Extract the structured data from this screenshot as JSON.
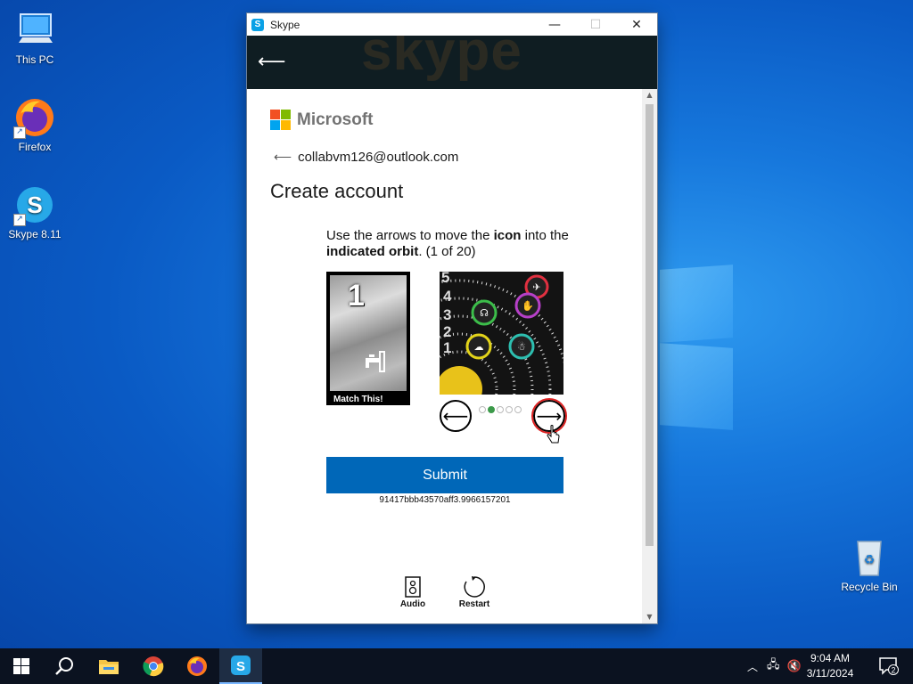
{
  "desktop": {
    "icons": [
      {
        "label": "This PC"
      },
      {
        "label": "Firefox"
      },
      {
        "label": "Skype 8.11"
      },
      {
        "label": "Recycle Bin"
      }
    ]
  },
  "window": {
    "title": "Skype",
    "watermark": "skype",
    "controls": {
      "minimize": "—",
      "maximize": "☐",
      "close": "✕"
    }
  },
  "signup": {
    "brand": "Microsoft",
    "brand_colors": [
      "#f25022",
      "#7fba00",
      "#00a4ef",
      "#ffb900"
    ],
    "email": "collabvm126@outlook.com",
    "heading": "Create account",
    "instruction": {
      "p1": "Use the arrows to move the ",
      "b1": "icon",
      "p2": " into the ",
      "b2": "indicated orbit",
      "p3": ". (1 of 20)"
    },
    "match_card": {
      "number": "1",
      "caption": "Match This!"
    },
    "orbit_numbers": [
      "5",
      "4",
      "3",
      "2",
      "1"
    ],
    "position_dots": {
      "total": 5,
      "active": 2
    },
    "submit_label": "Submit",
    "session_hash": "91417bbb43570aff3.9966157201",
    "audio_label": "Audio",
    "restart_label": "Restart"
  },
  "taskbar": {
    "apps": [
      "start",
      "search",
      "file-explorer",
      "chrome",
      "firefox",
      "skype"
    ],
    "active_app": "skype",
    "time": "9:04 AM",
    "date": "3/11/2024",
    "notification_count": "2"
  }
}
